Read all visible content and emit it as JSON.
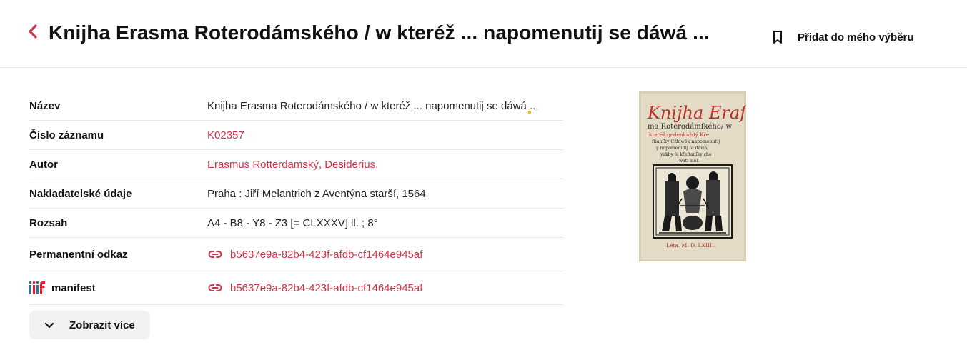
{
  "header": {
    "title": "Knijha Erasma Roterodámského / w kteréž ... napomenutij se dáwá ...",
    "bookmark_label": "Přidat do mého výběru"
  },
  "details": [
    {
      "label": "Název",
      "value": "Knijha Erasma Roterodámského / w kteréž ... napomenutij se dáwá ..."
    },
    {
      "label": "Číslo záznamu",
      "value": "K02357"
    },
    {
      "label": "Autor",
      "value": "Erasmus Rotterdamský, Desiderius,"
    },
    {
      "label": "Nakladatelské údaje",
      "value": "Praha : Jiří Melantrich z Aventýna starší, 1564"
    },
    {
      "label": "Rozsah",
      "value": "A4 - B8 - Y8 - Z3 [= CLXXXV] ll. ; 8°"
    },
    {
      "label": "Permanentní odkaz",
      "value": "b5637e9a-82b4-423f-afdb-cf1464e945af"
    },
    {
      "label": "manifest",
      "value": "b5637e9a-82b4-423f-afdb-cf1464e945af"
    }
  ],
  "show_more_label": "Zobrazit více",
  "cover": {
    "title_line1": "Knijha Eraſ",
    "title_line2": "ma Roterodámſkého/ w",
    "title_line3": "kteréž gedenkaždý Kře",
    "title_line4": "ſtianſký Cžlowěk napomenutij",
    "title_line5": "y napomenutij ſe dáwá/",
    "title_line6": "yakby ſe křeſtanſky cho",
    "title_line7": "wati měl.",
    "imprint": "Léta. M. D. LXIIII."
  },
  "colors": {
    "accent": "#d0334a",
    "divider": "#e6e6e6",
    "button_bg": "#f1f2f4"
  },
  "icons": {
    "back": "chevron-left-icon",
    "bookmark": "bookmark-icon",
    "link": "link-icon",
    "iiif": "iiif-icon",
    "expand": "chevron-down-icon"
  }
}
